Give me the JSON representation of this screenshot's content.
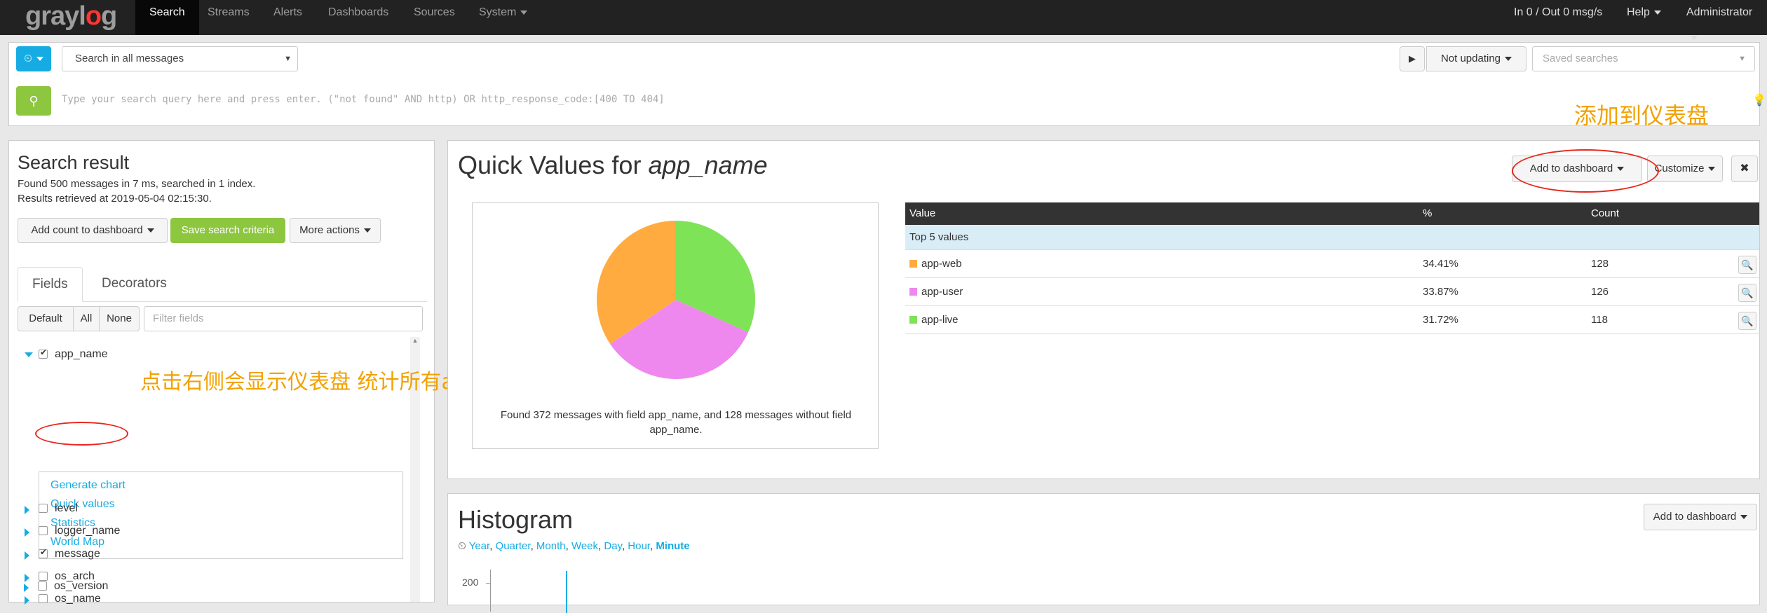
{
  "nav": {
    "logo": "graylog",
    "items": [
      "Search",
      "Streams",
      "Alerts",
      "Dashboards",
      "Sources",
      "System"
    ],
    "throughput": "In 0 / Out 0 msg/s",
    "help": "Help",
    "user": "Administrator"
  },
  "search": {
    "range_select": "Search in all messages",
    "update_label": "Not updating",
    "saved_searches_placeholder": "Saved searches",
    "query_placeholder": "Type your search query here and press enter. (\"not found\" AND http) OR http_response_code:[400 TO 404]"
  },
  "result": {
    "title": "Search result",
    "found_line": "Found 500 messages in 7 ms, searched in 1 index.",
    "retrieved_line": "Results retrieved at 2019-05-04 02:15:30.",
    "add_count_button": "Add count to dashboard",
    "save_button": "Save search criteria",
    "more_actions_button": "More actions"
  },
  "fields_panel": {
    "tabs": [
      "Fields",
      "Decorators"
    ],
    "filter_buttons": [
      "Default",
      "All",
      "None"
    ],
    "filter_placeholder": "Filter fields",
    "expanded_field": "app_name",
    "submenu": [
      "Generate chart",
      "Quick values",
      "Statistics",
      "World Map"
    ],
    "fields": [
      "level",
      "logger_name",
      "message",
      "os_arch",
      "os_name",
      "os_version"
    ],
    "checked": {
      "app_name": true,
      "level": false,
      "logger_name": false,
      "message": true,
      "os_arch": false,
      "os_name": false,
      "os_version": false
    }
  },
  "quick_values": {
    "title_prefix": "Quick Values for ",
    "field": "app_name",
    "add_to_dashboard": "Add to dashboard",
    "customize": "Customize",
    "caption": "Found 372 messages with field app_name, and 128 messages without field app_name.",
    "table_headers": [
      "Value",
      "%",
      "Count"
    ],
    "top_row": "Top 5 values",
    "rows": [
      {
        "value": "app-web",
        "pct": "34.41%",
        "count": "128",
        "color": "#ffab40"
      },
      {
        "value": "app-user",
        "pct": "33.87%",
        "count": "126",
        "color": "#ee88ee"
      },
      {
        "value": "app-live",
        "pct": "31.72%",
        "count": "118",
        "color": "#7ee356"
      }
    ]
  },
  "histogram": {
    "title": "Histogram",
    "add_to_dashboard": "Add to dashboard",
    "intervals": [
      "Year",
      "Quarter",
      "Month",
      "Week",
      "Day",
      "Hour",
      "Minute"
    ],
    "y_tick": "200"
  },
  "annotations": {
    "dashboard_note": "添加到仪表盘",
    "field_note": "点击右侧会显示仪表盘 统计所有app_name的应用"
  },
  "chart_data": {
    "type": "pie",
    "categories": [
      "app-web",
      "app-user",
      "app-live"
    ],
    "values": [
      34.41,
      33.87,
      31.72
    ],
    "colors": [
      "#ffab40",
      "#ee88ee",
      "#7ee356"
    ]
  }
}
